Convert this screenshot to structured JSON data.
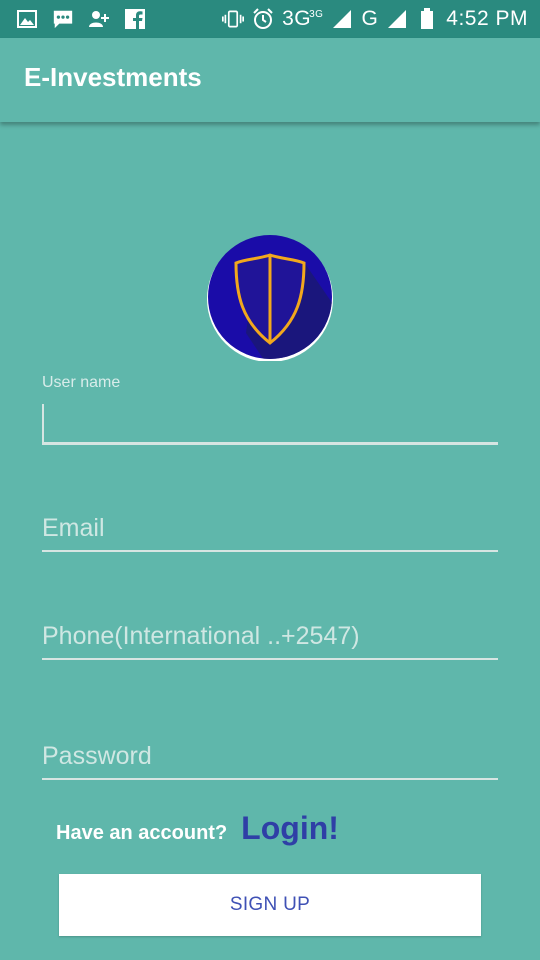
{
  "status_bar": {
    "left_icons": [
      "gallery-icon",
      "message-icon",
      "add-contact-icon",
      "facebook-icon"
    ],
    "right_icons": [
      "vibrate-icon",
      "alarm-icon",
      "signal-icon",
      "signal-icon",
      "battery-icon"
    ],
    "network_primary": "3G",
    "network_primary_sup": "3G",
    "network_secondary": "G",
    "time": "4:52 PM"
  },
  "app_bar": {
    "title": "E-Investments"
  },
  "logo": {
    "icon": "shield-icon",
    "colors": {
      "circle": "#1a0ca8",
      "shadow": "#1b1a6e",
      "outline": "#f2a81d"
    }
  },
  "form": {
    "username": {
      "label": "User name",
      "value": ""
    },
    "email": {
      "placeholder": "Email",
      "value": ""
    },
    "phone": {
      "placeholder": "Phone(International ..+2547)",
      "value": ""
    },
    "password": {
      "placeholder": "Password",
      "value": ""
    }
  },
  "login_prompt": {
    "text": "Have an account?",
    "link": "Login!"
  },
  "signup": {
    "label": "SIGN UP"
  },
  "colors": {
    "background": "#5fb7ab",
    "status_bar": "#2a8a7f",
    "accent": "#3f51b5",
    "login_link": "#2f3fa6"
  }
}
